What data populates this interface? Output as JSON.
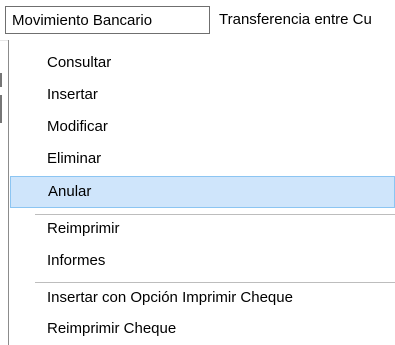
{
  "menubar": {
    "items": [
      {
        "label": "Movimiento Bancario"
      },
      {
        "label": "Transferencia entre Cu"
      }
    ]
  },
  "menu": {
    "items": [
      {
        "label": "Consultar"
      },
      {
        "label": "Insertar"
      },
      {
        "label": "Modificar"
      },
      {
        "label": "Eliminar"
      },
      {
        "label": "Anular"
      },
      {
        "label": "Reimprimir"
      },
      {
        "label": "Informes"
      },
      {
        "label": "Insertar con Opción Imprimir Cheque"
      },
      {
        "label": "Reimprimir Cheque"
      }
    ]
  },
  "colors": {
    "highlight_background": "#cfe5fb",
    "highlight_border": "#8cc5f2",
    "separator": "#bdbdbd"
  }
}
